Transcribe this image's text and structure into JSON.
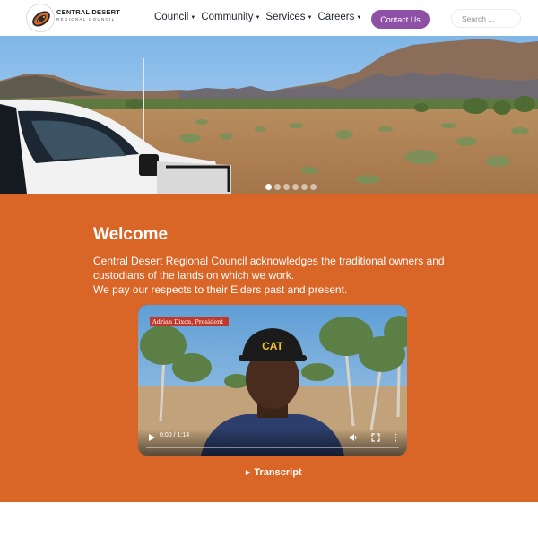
{
  "header": {
    "logo_title": "CENTRAL DESERT",
    "logo_subtitle": "REGIONAL COUNCIL",
    "nav": [
      {
        "label": "Council",
        "icon": "chevron-down-icon"
      },
      {
        "label": "Community",
        "icon": "chevron-down-icon"
      },
      {
        "label": "Services",
        "icon": "chevron-down-icon"
      },
      {
        "label": "Careers",
        "icon": "chevron-down-icon"
      }
    ],
    "contact_label": "Contact Us",
    "search_placeholder": "Search ..."
  },
  "hero": {
    "slide_count": 6,
    "active_slide": 1
  },
  "welcome": {
    "title": "Welcome",
    "ack_lines": [
      "Central Desert Regional Council acknowledges the traditional owners and",
      "custodians of the lands on which we work.",
      "We pay our respects to their Elders past and present."
    ],
    "video": {
      "caption": "Adrian Dixon, President",
      "time": "0:00 / 1:14",
      "progress": 0
    },
    "transcript_label": "Transcript"
  },
  "colors": {
    "accent_purple": "#8e4fa6",
    "section_orange": "#d96527"
  }
}
